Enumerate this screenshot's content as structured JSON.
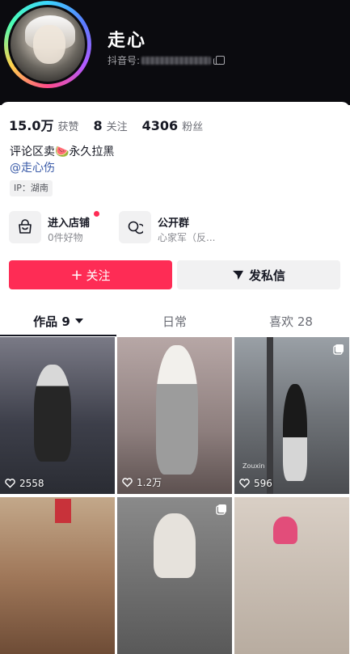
{
  "profile": {
    "name": "走心",
    "douyin_label": "抖音号:",
    "stats": [
      {
        "num": "15.0万",
        "label": "获赞"
      },
      {
        "num": "8",
        "label": "关注"
      },
      {
        "num": "4306",
        "label": "粉丝"
      }
    ],
    "bio": "评论区卖🍉永久拉黑",
    "mention": "@走心伤",
    "ip": "IP：湖南"
  },
  "features": {
    "shop": {
      "title": "进入店铺",
      "subtitle": "0件好物"
    },
    "group": {
      "title": "公开群",
      "subtitle": "心家军（反..."
    }
  },
  "actions": {
    "follow": "关注",
    "message": "发私信"
  },
  "tabs": [
    {
      "label": "作品 9",
      "active": true
    },
    {
      "label": "日常",
      "active": false
    },
    {
      "label": "喜欢 28",
      "active": false
    }
  ],
  "videos": [
    {
      "likes": "2558",
      "multi": false
    },
    {
      "likes": "1.2万",
      "multi": false
    },
    {
      "likes": "596",
      "multi": true,
      "watermark": "Zouxin"
    },
    {
      "likes": "",
      "multi": false
    },
    {
      "likes": "",
      "multi": true
    },
    {
      "likes": "",
      "multi": false
    }
  ],
  "colors": {
    "accent": "#fe2c55",
    "link": "#3a5ba8",
    "header_bg": "#0b0b0f"
  }
}
